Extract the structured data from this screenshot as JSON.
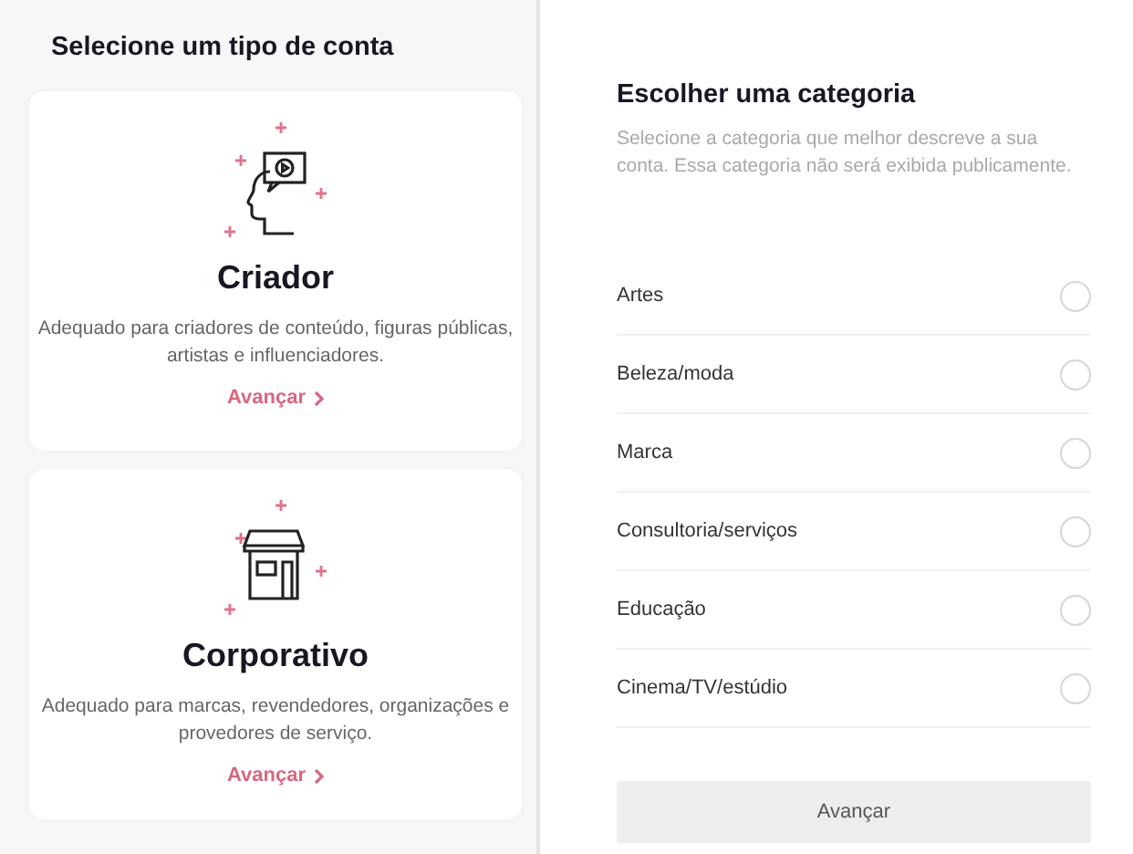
{
  "account_types": {
    "title": "Selecione um tipo de conta",
    "cards": [
      {
        "kind": "creator",
        "title": "Criador",
        "description": "Adequado para criadores de conteúdo, figuras públicas, artistas e influenciadores.",
        "link": "Avançar"
      },
      {
        "kind": "business",
        "title": "Corporativo",
        "description": "Adequado para marcas, revendedores, organizações e provedores de serviço.",
        "link": "Avançar"
      }
    ]
  },
  "category": {
    "title": "Escolher uma categoria",
    "description": "Selecione a categoria que melhor descreve a sua conta. Essa categoria não será exibida publicamente.",
    "options": [
      {
        "label": "Artes",
        "selected": false
      },
      {
        "label": "Beleza/moda",
        "selected": false
      },
      {
        "label": "Marca",
        "selected": false
      },
      {
        "label": "Consultoria/serviços",
        "selected": false
      },
      {
        "label": "Educação",
        "selected": false
      },
      {
        "label": "Cinema/TV/estúdio",
        "selected": false
      }
    ],
    "button": {
      "label": "Avançar",
      "disabled": true
    }
  }
}
